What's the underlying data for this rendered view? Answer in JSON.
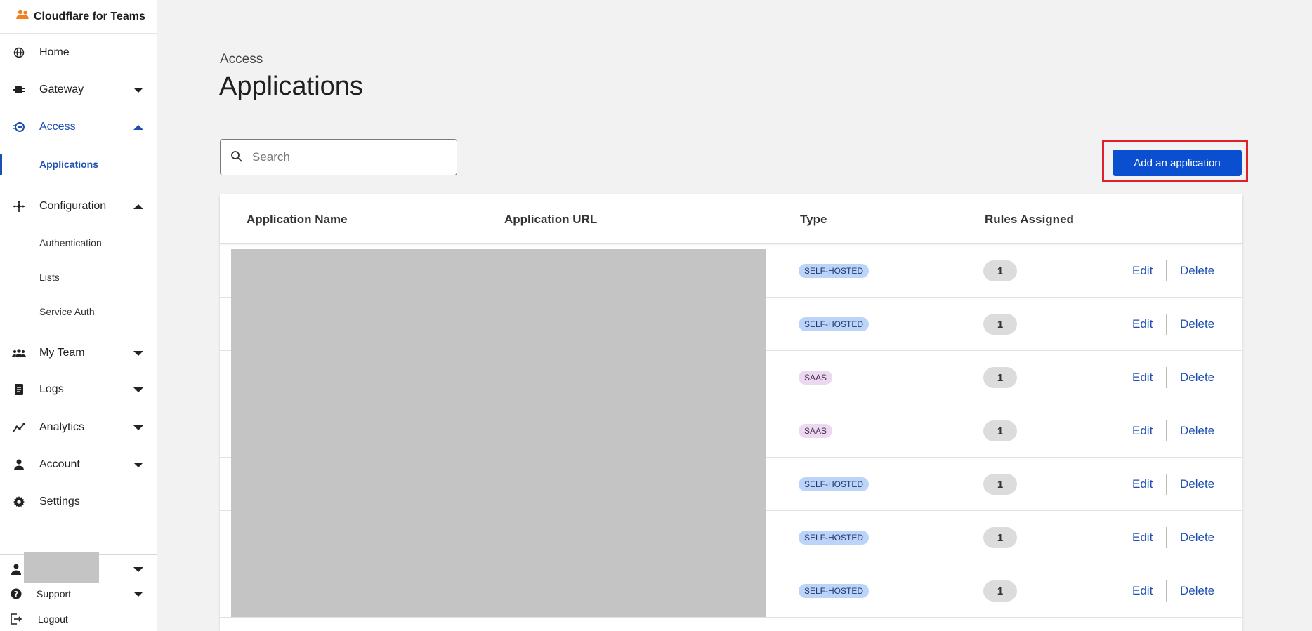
{
  "brand": {
    "title": "Cloudflare for Teams"
  },
  "sidebar": {
    "items": [
      {
        "label": "Home"
      },
      {
        "label": "Gateway"
      },
      {
        "label": "Access"
      },
      {
        "label": "Applications"
      },
      {
        "label": "Configuration"
      },
      {
        "label": "Authentication"
      },
      {
        "label": "Lists"
      },
      {
        "label": "Service Auth"
      },
      {
        "label": "My Team"
      },
      {
        "label": "Logs"
      },
      {
        "label": "Analytics"
      },
      {
        "label": "Account"
      },
      {
        "label": "Settings"
      }
    ],
    "footer": {
      "support_label": "Support",
      "logout_label": "Logout"
    }
  },
  "page": {
    "breadcrumb": "Access",
    "title": "Applications",
    "search_placeholder": "Search",
    "add_button_label": "Add an application"
  },
  "table": {
    "headers": [
      "Application Name",
      "Application URL",
      "Type",
      "Rules Assigned"
    ],
    "rows": [
      {
        "type": "SELF-HOSTED",
        "rules": "1",
        "edit": "Edit",
        "delete": "Delete"
      },
      {
        "type": "SELF-HOSTED",
        "rules": "1",
        "edit": "Edit",
        "delete": "Delete"
      },
      {
        "type": "SAAS",
        "rules": "1",
        "edit": "Edit",
        "delete": "Delete"
      },
      {
        "type": "SAAS",
        "rules": "1",
        "edit": "Edit",
        "delete": "Delete"
      },
      {
        "type": "SELF-HOSTED",
        "rules": "1",
        "edit": "Edit",
        "delete": "Delete"
      },
      {
        "type": "SELF-HOSTED",
        "rules": "1",
        "edit": "Edit",
        "delete": "Delete"
      },
      {
        "type": "SELF-HOSTED",
        "rules": "1",
        "edit": "Edit",
        "delete": "Delete"
      }
    ]
  },
  "colors": {
    "accent": "#1d4fb2",
    "primary_button": "#0a4fcf",
    "highlight": "#e0202a",
    "self_hosted_badge": "#bcd4f8",
    "saas_badge": "#ecd9ef"
  }
}
